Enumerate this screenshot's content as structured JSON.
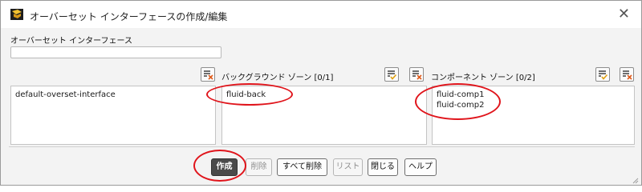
{
  "window": {
    "title": "オーバーセット インターフェースの作成/編集"
  },
  "name_field": {
    "label": "オーバーセット インターフェース",
    "value": ""
  },
  "interfaces": {
    "items": [
      "default-overset-interface"
    ]
  },
  "background_zones": {
    "label": "バックグラウンド ゾーン [0/1]",
    "items": [
      "fluid-back"
    ]
  },
  "component_zones": {
    "label": "コンポーネント ゾーン [0/2]",
    "items": [
      "fluid-comp1",
      "fluid-comp2"
    ]
  },
  "buttons": {
    "create": "作成",
    "delete": "削除",
    "delete_all": "すべて削除",
    "list": "リスト",
    "close": "閉じる",
    "help": "ヘルプ"
  },
  "colors": {
    "highlight": "#e0141b",
    "primary_button": "#4a4a4a"
  },
  "icons": [
    "app-icon",
    "close-icon",
    "deselect-all-icon",
    "select-all-icon",
    "resize-grip-icon"
  ]
}
